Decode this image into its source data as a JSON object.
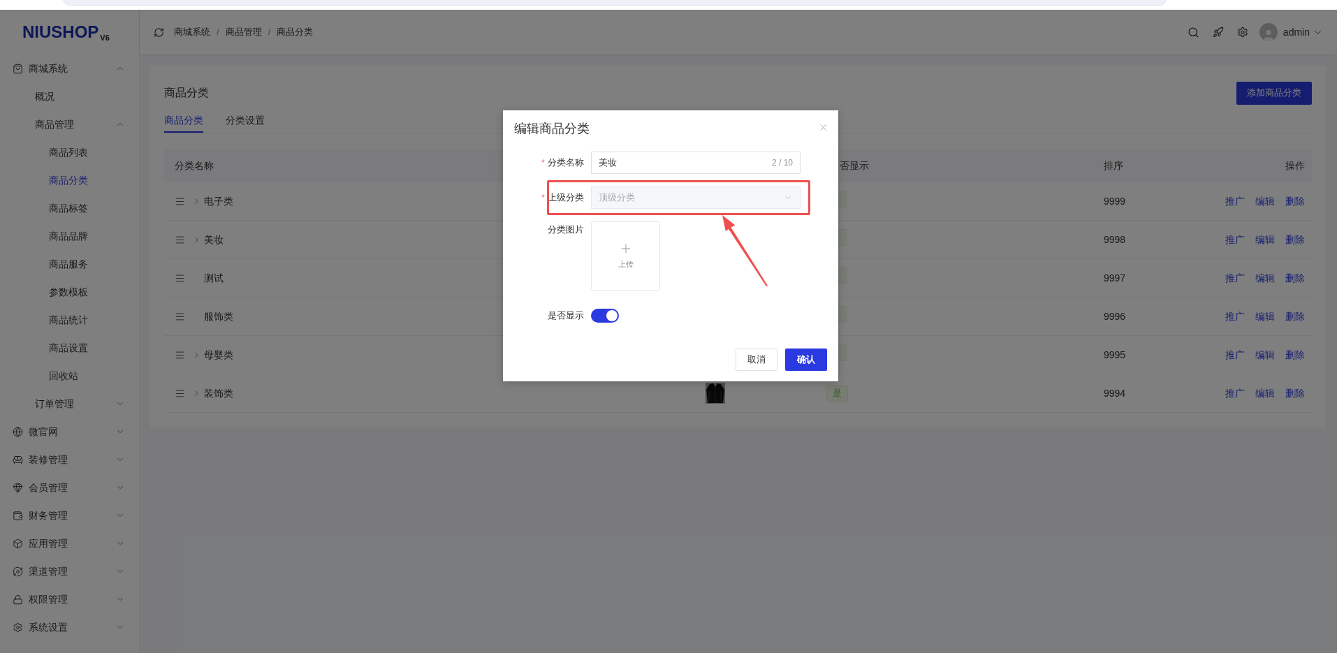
{
  "logo": {
    "name": "NIUSHOP",
    "version": "V6"
  },
  "sidebar": {
    "items": [
      {
        "label": "商城系统",
        "expanded": true,
        "children": [
          {
            "label": "概况",
            "selected": false
          },
          {
            "label": "商品管理",
            "expanded": true,
            "children": [
              {
                "label": "商品列表",
                "selected": false
              },
              {
                "label": "商品分类",
                "selected": true
              },
              {
                "label": "商品标签",
                "selected": false
              },
              {
                "label": "商品品牌",
                "selected": false
              },
              {
                "label": "商品服务",
                "selected": false
              },
              {
                "label": "参数模板",
                "selected": false
              },
              {
                "label": "商品统计",
                "selected": false
              },
              {
                "label": "商品设置",
                "selected": false
              },
              {
                "label": "回收站",
                "selected": false
              }
            ]
          },
          {
            "label": "订单管理",
            "expanded": false
          }
        ]
      },
      {
        "label": "微官网",
        "expanded": false
      },
      {
        "label": "装修管理",
        "expanded": false
      },
      {
        "label": "会员管理",
        "expanded": false
      },
      {
        "label": "财务管理",
        "expanded": false
      },
      {
        "label": "应用管理",
        "expanded": false
      },
      {
        "label": "渠道管理",
        "expanded": false
      },
      {
        "label": "权限管理",
        "expanded": false
      },
      {
        "label": "系统设置",
        "expanded": false
      }
    ]
  },
  "header": {
    "breadcrumb": [
      "商城系统",
      "商品管理",
      "商品分类"
    ],
    "separator": "/",
    "user": "admin"
  },
  "page": {
    "title": "商品分类",
    "add_button": "添加商品分类",
    "tabs": [
      {
        "label": "商品分类",
        "selected": true
      },
      {
        "label": "分类设置",
        "selected": false
      }
    ]
  },
  "table": {
    "columns": [
      "分类名称",
      "否显示",
      "排序",
      "操作"
    ],
    "rows": [
      {
        "name": "电子类",
        "expandable": true,
        "shown": true,
        "sort": "9999",
        "actions": [
          "推广",
          "编辑",
          "删除"
        ]
      },
      {
        "name": "美妆",
        "expandable": true,
        "shown": true,
        "sort": "9998",
        "actions": [
          "推广",
          "编辑",
          "删除"
        ]
      },
      {
        "name": "测试",
        "expandable": false,
        "shown": true,
        "sort": "9997",
        "actions": [
          "推广",
          "编辑",
          "删除"
        ]
      },
      {
        "name": "服饰类",
        "expandable": false,
        "shown": true,
        "sort": "9996",
        "actions": [
          "推广",
          "编辑",
          "删除"
        ]
      },
      {
        "name": "母婴类",
        "expandable": true,
        "shown": true,
        "sort": "9995",
        "actions": [
          "推广",
          "编辑",
          "删除"
        ]
      },
      {
        "name": "装饰类",
        "expandable": true,
        "image": {
          "kind": "picture"
        },
        "shown": true,
        "shown_label": "是",
        "sort": "9994",
        "actions": [
          "推广",
          "编辑",
          "删除"
        ]
      }
    ]
  },
  "modal": {
    "title": "编辑商品分类",
    "name_field": {
      "label": "分类名称",
      "required_mark": "*",
      "value": "美妆",
      "counter": "2 / 10"
    },
    "parent_field": {
      "label": "上级分类",
      "required_mark": "*",
      "value": "顶级分类",
      "disabled": true,
      "highlighted": true
    },
    "image_field": {
      "label": "分类图片",
      "upload_label": "上传"
    },
    "show_field": {
      "label": "是否显示",
      "on": true
    },
    "buttons": {
      "cancel": "取消",
      "confirm": "确认"
    }
  }
}
